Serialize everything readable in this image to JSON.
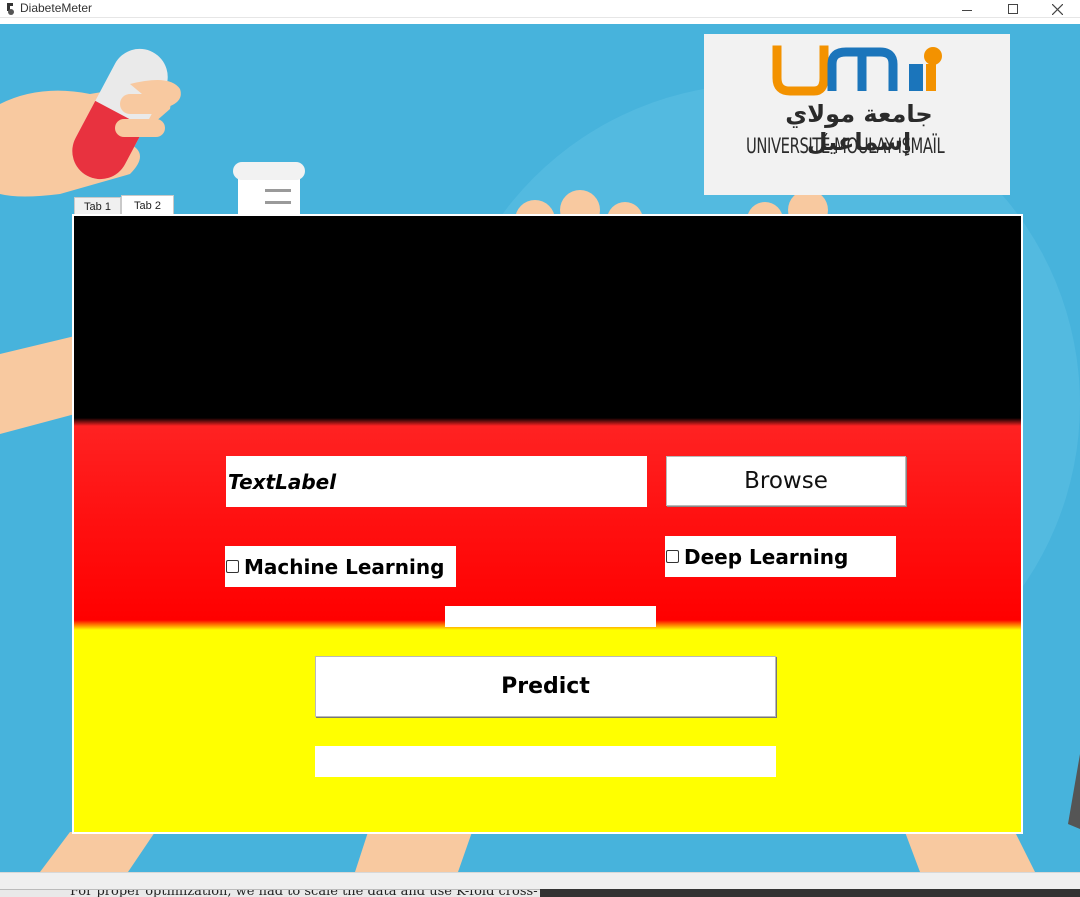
{
  "window": {
    "title": "DiabeteMeter",
    "minimize_glyph": "—",
    "close_glyph": "✕"
  },
  "logo": {
    "brand": "umi",
    "arabic_name": "جامعة مولاي إسماعيل",
    "latin_name": "UNIVERSITÉ MOULAY ISMAÏL"
  },
  "tabs": [
    {
      "label": "Tab 1",
      "selected": false
    },
    {
      "label": "Tab 2",
      "selected": true
    }
  ],
  "form": {
    "file_label": "TextLabel",
    "browse_label": "Browse",
    "machine_learning_label": "Machine Learning",
    "machine_learning_checked": false,
    "deep_learning_label": "Deep Learning",
    "deep_learning_checked": false,
    "status_text": "",
    "predict_label": "Predict",
    "result_text": ""
  },
  "background_window_text": "For proper optimization, we had to scale the data and use K-fold cross-",
  "colors": {
    "background_blue": "#47b3dc",
    "band_black": "#000000",
    "band_red": "#ff0000",
    "band_yellow": "#ffff00",
    "logo_orange": "#f39200",
    "logo_blue": "#1b75bb"
  }
}
